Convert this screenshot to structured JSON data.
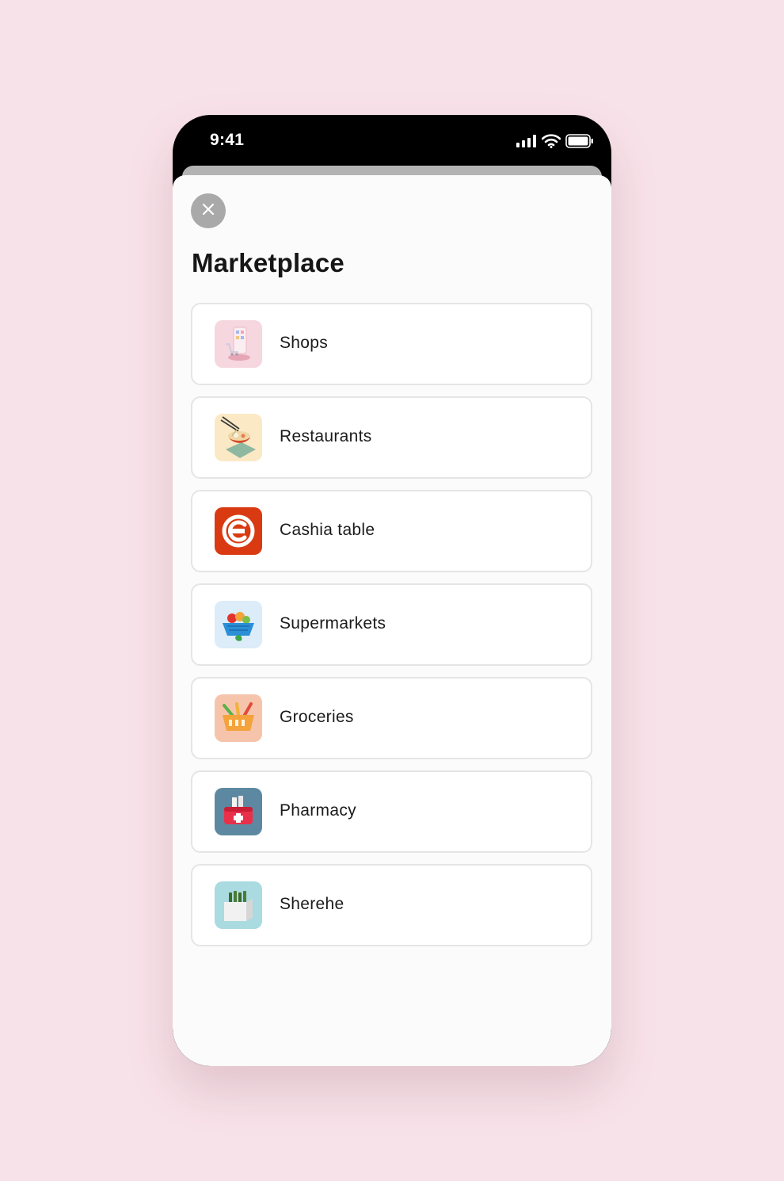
{
  "status_bar": {
    "time": "9:41"
  },
  "sheet": {
    "title": "Marketplace"
  },
  "items": [
    {
      "label": "Shops",
      "icon": "shopping-phone-icon",
      "icon_bg": "#f6d6df"
    },
    {
      "label": "Restaurants",
      "icon": "ramen-bowl-icon",
      "icon_bg": "#fbe9c6"
    },
    {
      "label": "Cashia table",
      "icon": "cashia-logo-icon",
      "icon_bg": "#d93a12"
    },
    {
      "label": "Supermarkets",
      "icon": "fruit-basket-icon",
      "icon_bg": "#dcecf8"
    },
    {
      "label": "Groceries",
      "icon": "grocery-basket-icon",
      "icon_bg": "#f6c4ab"
    },
    {
      "label": "Pharmacy",
      "icon": "first-aid-kit-icon",
      "icon_bg": "#5c89a1"
    },
    {
      "label": "Sherehe",
      "icon": "bottle-crate-icon",
      "icon_bg": "#a9dbe0"
    }
  ],
  "colors": {
    "background": "#f8e2e9",
    "sheet": "#fbfbfb",
    "close_button": "#a9a9a9",
    "home_indicator": "#141a35"
  }
}
